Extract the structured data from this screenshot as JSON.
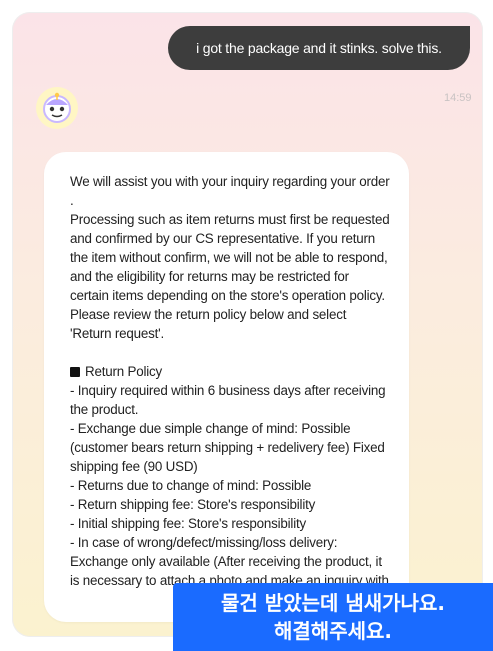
{
  "chat": {
    "user_message": "i got the package and it stinks. solve this.",
    "timestamp": "14:59",
    "bot_message": {
      "intro": [
        "We will assist you with your inquiry regarding your order .",
        "Processing such as item returns must first be requested and confirmed by our CS representative. If you return the item without confirm, we will not be able to respond, and the eligibility for returns may be restricted for certain items depending on the store's operation policy.",
        "Please review the return policy below and select 'Return request'."
      ],
      "policy_title": "Return Policy",
      "policy_items": [
        "- Inquiry required within 6 business days after receiving the product.",
        "- Exchange due simple change of mind: Possible (customer bears return shipping + redelivery fee) Fixed shipping fee (90 USD)",
        "- Returns due to change of mind: Possible",
        "- Return shipping fee: Store's responsibility",
        "- Initial shipping fee: Store's responsibility",
        "- In case of wrong/defect/missing/loss delivery: Exchange only available (After receiving the product, it is necessary to attach a photo and make an inquiry with"
      ]
    }
  },
  "caption": {
    "line1": "물건 받았는데 냄새가나요.",
    "line2": "해결해주세요."
  },
  "colors": {
    "user_bubble": "#3d3d3d",
    "caption_bg": "#1a6bff",
    "avatar_bg": "#fff6c4"
  },
  "icons": {
    "avatar": "chatbot-avatar-icon",
    "policy_bullet": "black-square-icon"
  }
}
